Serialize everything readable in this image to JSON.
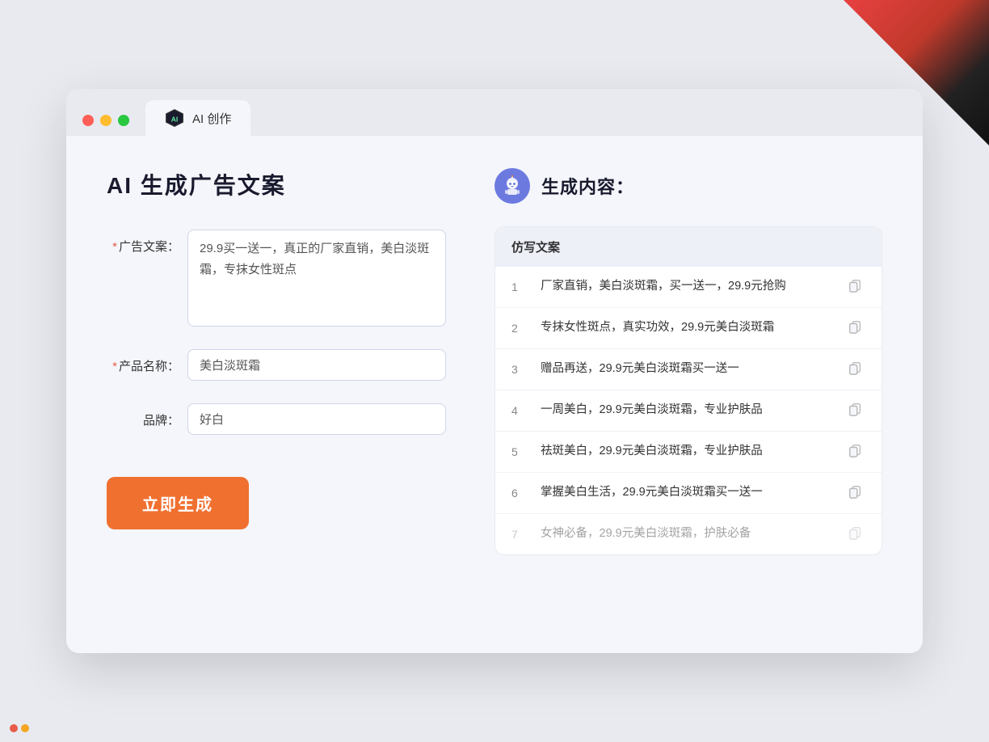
{
  "browser": {
    "tab_label": "AI 创作"
  },
  "page": {
    "title": "AI 生成广告文案",
    "right_title": "生成内容："
  },
  "form": {
    "ad_text_label": "广告文案：",
    "ad_text_required": "*",
    "ad_text_value": "29.9买一送一，真正的厂家直销，美白淡斑霜，专抹女性斑点",
    "product_label": "产品名称：",
    "product_required": "*",
    "product_value": "美白淡斑霜",
    "brand_label": "品牌：",
    "brand_value": "好白",
    "generate_button": "立即生成"
  },
  "results": {
    "header": "仿写文案",
    "items": [
      {
        "num": "1",
        "text": "厂家直销，美白淡斑霜，买一送一，29.9元抢购",
        "faded": false
      },
      {
        "num": "2",
        "text": "专抹女性斑点，真实功效，29.9元美白淡斑霜",
        "faded": false
      },
      {
        "num": "3",
        "text": "赠品再送，29.9元美白淡斑霜买一送一",
        "faded": false
      },
      {
        "num": "4",
        "text": "一周美白，29.9元美白淡斑霜，专业护肤品",
        "faded": false
      },
      {
        "num": "5",
        "text": "祛斑美白，29.9元美白淡斑霜，专业护肤品",
        "faded": false
      },
      {
        "num": "6",
        "text": "掌握美白生活，29.9元美白淡斑霜买一送一",
        "faded": false
      },
      {
        "num": "7",
        "text": "女神必备，29.9元美白淡斑霜，护肤必备",
        "faded": true
      }
    ]
  },
  "icons": {
    "robot": "🤖",
    "copy": "📋"
  }
}
